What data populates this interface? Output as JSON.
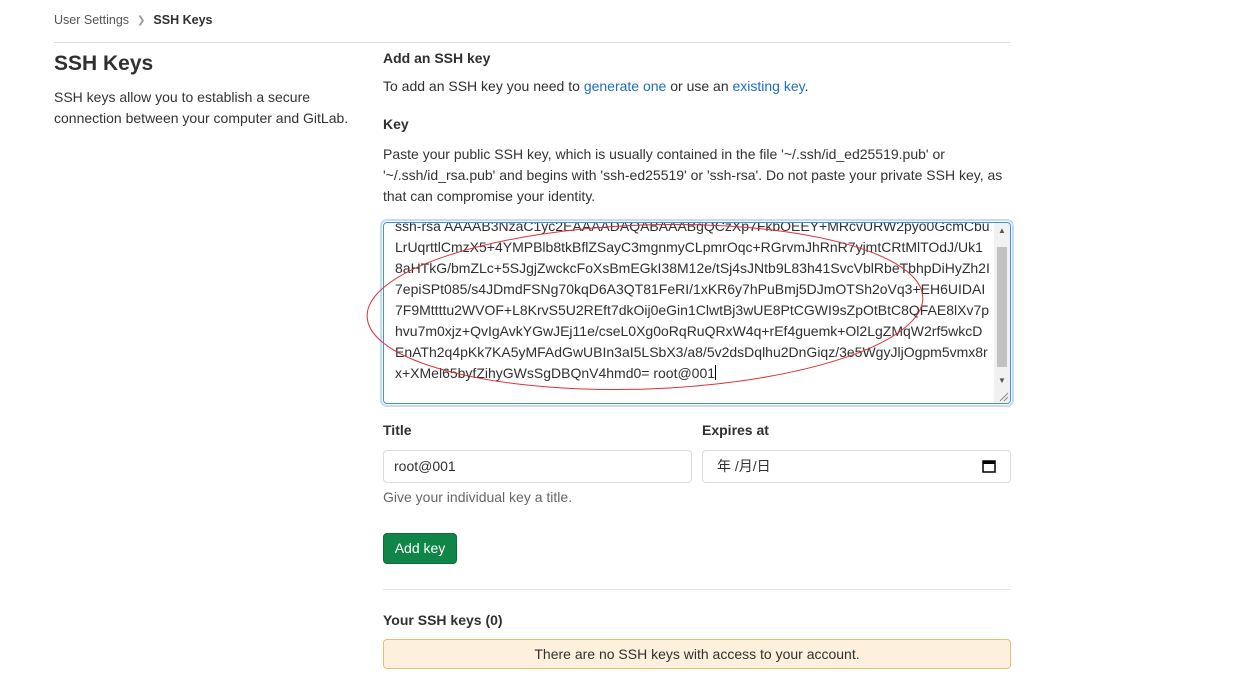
{
  "breadcrumb": {
    "parent": "User Settings",
    "current": "SSH Keys"
  },
  "sidebar": {
    "title": "SSH Keys",
    "description": "SSH keys allow you to establish a secure connection between your computer and GitLab."
  },
  "form": {
    "section_title": "Add an SSH key",
    "intro": {
      "prefix": "To add an SSH key you need to ",
      "link1": "generate one",
      "middle": " or use an ",
      "link2": "existing key",
      "suffix": "."
    },
    "key_label": "Key",
    "key_help": "Paste your public SSH key, which is usually contained in the file '~/.ssh/id_ed25519.pub' or '~/.ssh/id_rsa.pub' and begins with 'ssh-ed25519' or 'ssh-rsa'. Do not paste your private SSH key, as that can compromise your identity.",
    "key_value": "ssh-rsa AAAAB3NzaC1yc2EAAAADAQABAAABgQCzXp7FkbOEEY+MRcvURW2pyo0GcmCbuLrUqrttlCmzX5+4YMPBlb8tkBflZSayC3mgnmyCLpmrOqc+RGrvmJhRnR7yjmtCRtMlTOdJ/Uk18aHTkG/bmZLc+5SJgjZwckcFoXsBmEGkI38M12e/tSj4sJNtb9L83h41SvcVblRbeTbhpDiHyZh2I7epiSPt085/s4JDmdFSNg70kqD6A3QT81FeRI/1xKR6y7hPuBmj5DJmOTSh2oVq3+EH6UIDAI7F9Mttttu2WVOF+L8KrvS5U2REft7dkOij0eGin1ClwtBj3wUE8PtCGWI9sZpOtBtC8QFAE8lXv7phvu7m0xjz+QvIgAvkYGwJEj11e/cseL0Xg0oRqRuQRxW4q+rEf4guemk+Ol2LgZMqW2rf5wkcDEnATh2q4pKk7KA5yMFAdGwUBIn3aI5LSbX3/a8/5v2dsDqlhu2DnGiqz/3e5WgyJljOgpm5vmx8rx+XMel65byfZihyGWsSgDBQnV4hmd0= root@001",
    "title_label": "Title",
    "title_value": "root@001",
    "expires_label": "Expires at",
    "expires_placeholder": "年 /月/日",
    "title_help": "Give your individual key a title.",
    "submit_label": "Add key"
  },
  "keys_list": {
    "heading": "Your SSH keys (0)",
    "empty_message": "There are no SSH keys with access to your account."
  },
  "colors": {
    "primary_button": "#108548",
    "link": "#1f6fbf",
    "focus_border": "#428fdc",
    "alert_bg": "#fdf1dd",
    "annotation": "#d9333a"
  },
  "icons": {
    "calendar": "calendar-icon",
    "breadcrumb_separator": "chevron-right-icon"
  }
}
